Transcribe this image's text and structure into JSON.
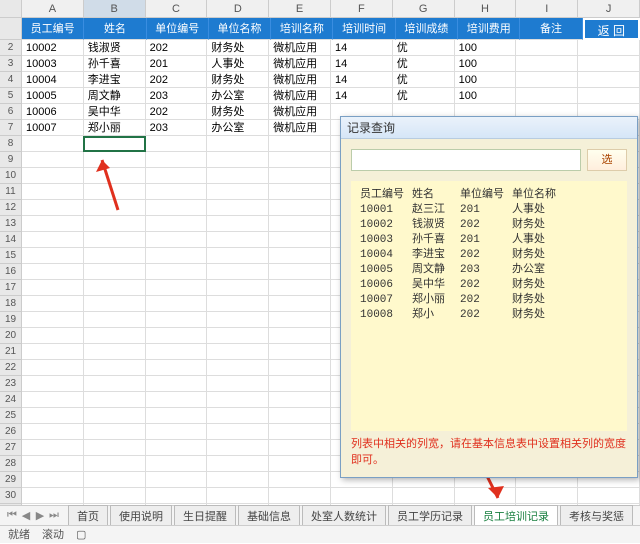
{
  "columns": [
    "A",
    "B",
    "C",
    "D",
    "E",
    "F",
    "G",
    "H",
    "I",
    "J"
  ],
  "header": {
    "cols": [
      "员工编号",
      "姓名",
      "单位编号",
      "单位名称",
      "培训名称",
      "培训时间",
      "培训成绩",
      "培训费用",
      "备注"
    ],
    "return": "返 回"
  },
  "rows": [
    {
      "n": "2",
      "c": [
        "10002",
        "钱淑贤",
        "202",
        "财务处",
        "微机应用",
        "14",
        "优",
        "100",
        "",
        ""
      ]
    },
    {
      "n": "3",
      "c": [
        "10003",
        "孙千喜",
        "201",
        "人事处",
        "微机应用",
        "14",
        "优",
        "100",
        "",
        ""
      ]
    },
    {
      "n": "4",
      "c": [
        "10004",
        "李进宝",
        "202",
        "财务处",
        "微机应用",
        "14",
        "优",
        "100",
        "",
        ""
      ]
    },
    {
      "n": "5",
      "c": [
        "10005",
        "周文静",
        "203",
        "办公室",
        "微机应用",
        "14",
        "优",
        "100",
        "",
        ""
      ]
    },
    {
      "n": "6",
      "c": [
        "10006",
        "吴中华",
        "202",
        "财务处",
        "微机应用",
        "",
        "",
        "",
        "",
        ""
      ]
    },
    {
      "n": "7",
      "c": [
        "10007",
        "郑小丽",
        "203",
        "办公室",
        "微机应用",
        "",
        "",
        "",
        "",
        ""
      ]
    }
  ],
  "dialog": {
    "title": "记录查询",
    "btn": "选",
    "headers": [
      "员工编号",
      "姓名",
      "单位编号",
      "单位名称"
    ],
    "rows": [
      [
        "10001",
        "赵三江",
        "201",
        "人事处"
      ],
      [
        "10002",
        "钱淑贤",
        "202",
        "财务处"
      ],
      [
        "10003",
        "孙千喜",
        "201",
        "人事处"
      ],
      [
        "10004",
        "李进宝",
        "202",
        "财务处"
      ],
      [
        "10005",
        "周文静",
        "203",
        "办公室"
      ],
      [
        "10006",
        "吴中华",
        "202",
        "财务处"
      ],
      [
        "10007",
        "郑小丽",
        "202",
        "财务处"
      ],
      [
        "10008",
        "郑小",
        "202",
        "财务处"
      ]
    ],
    "footer": "列表中相关的列宽，请在基本信息表中设置相关列的宽度即可。"
  },
  "tabs": [
    "首页",
    "使用说明",
    "生日提醒",
    "基础信息",
    "处室人数统计",
    "员工学历记录",
    "员工培训记录",
    "考核与奖惩"
  ],
  "active_tab": 6,
  "status": {
    "ready": "就绪",
    "scroll": "滚动"
  }
}
